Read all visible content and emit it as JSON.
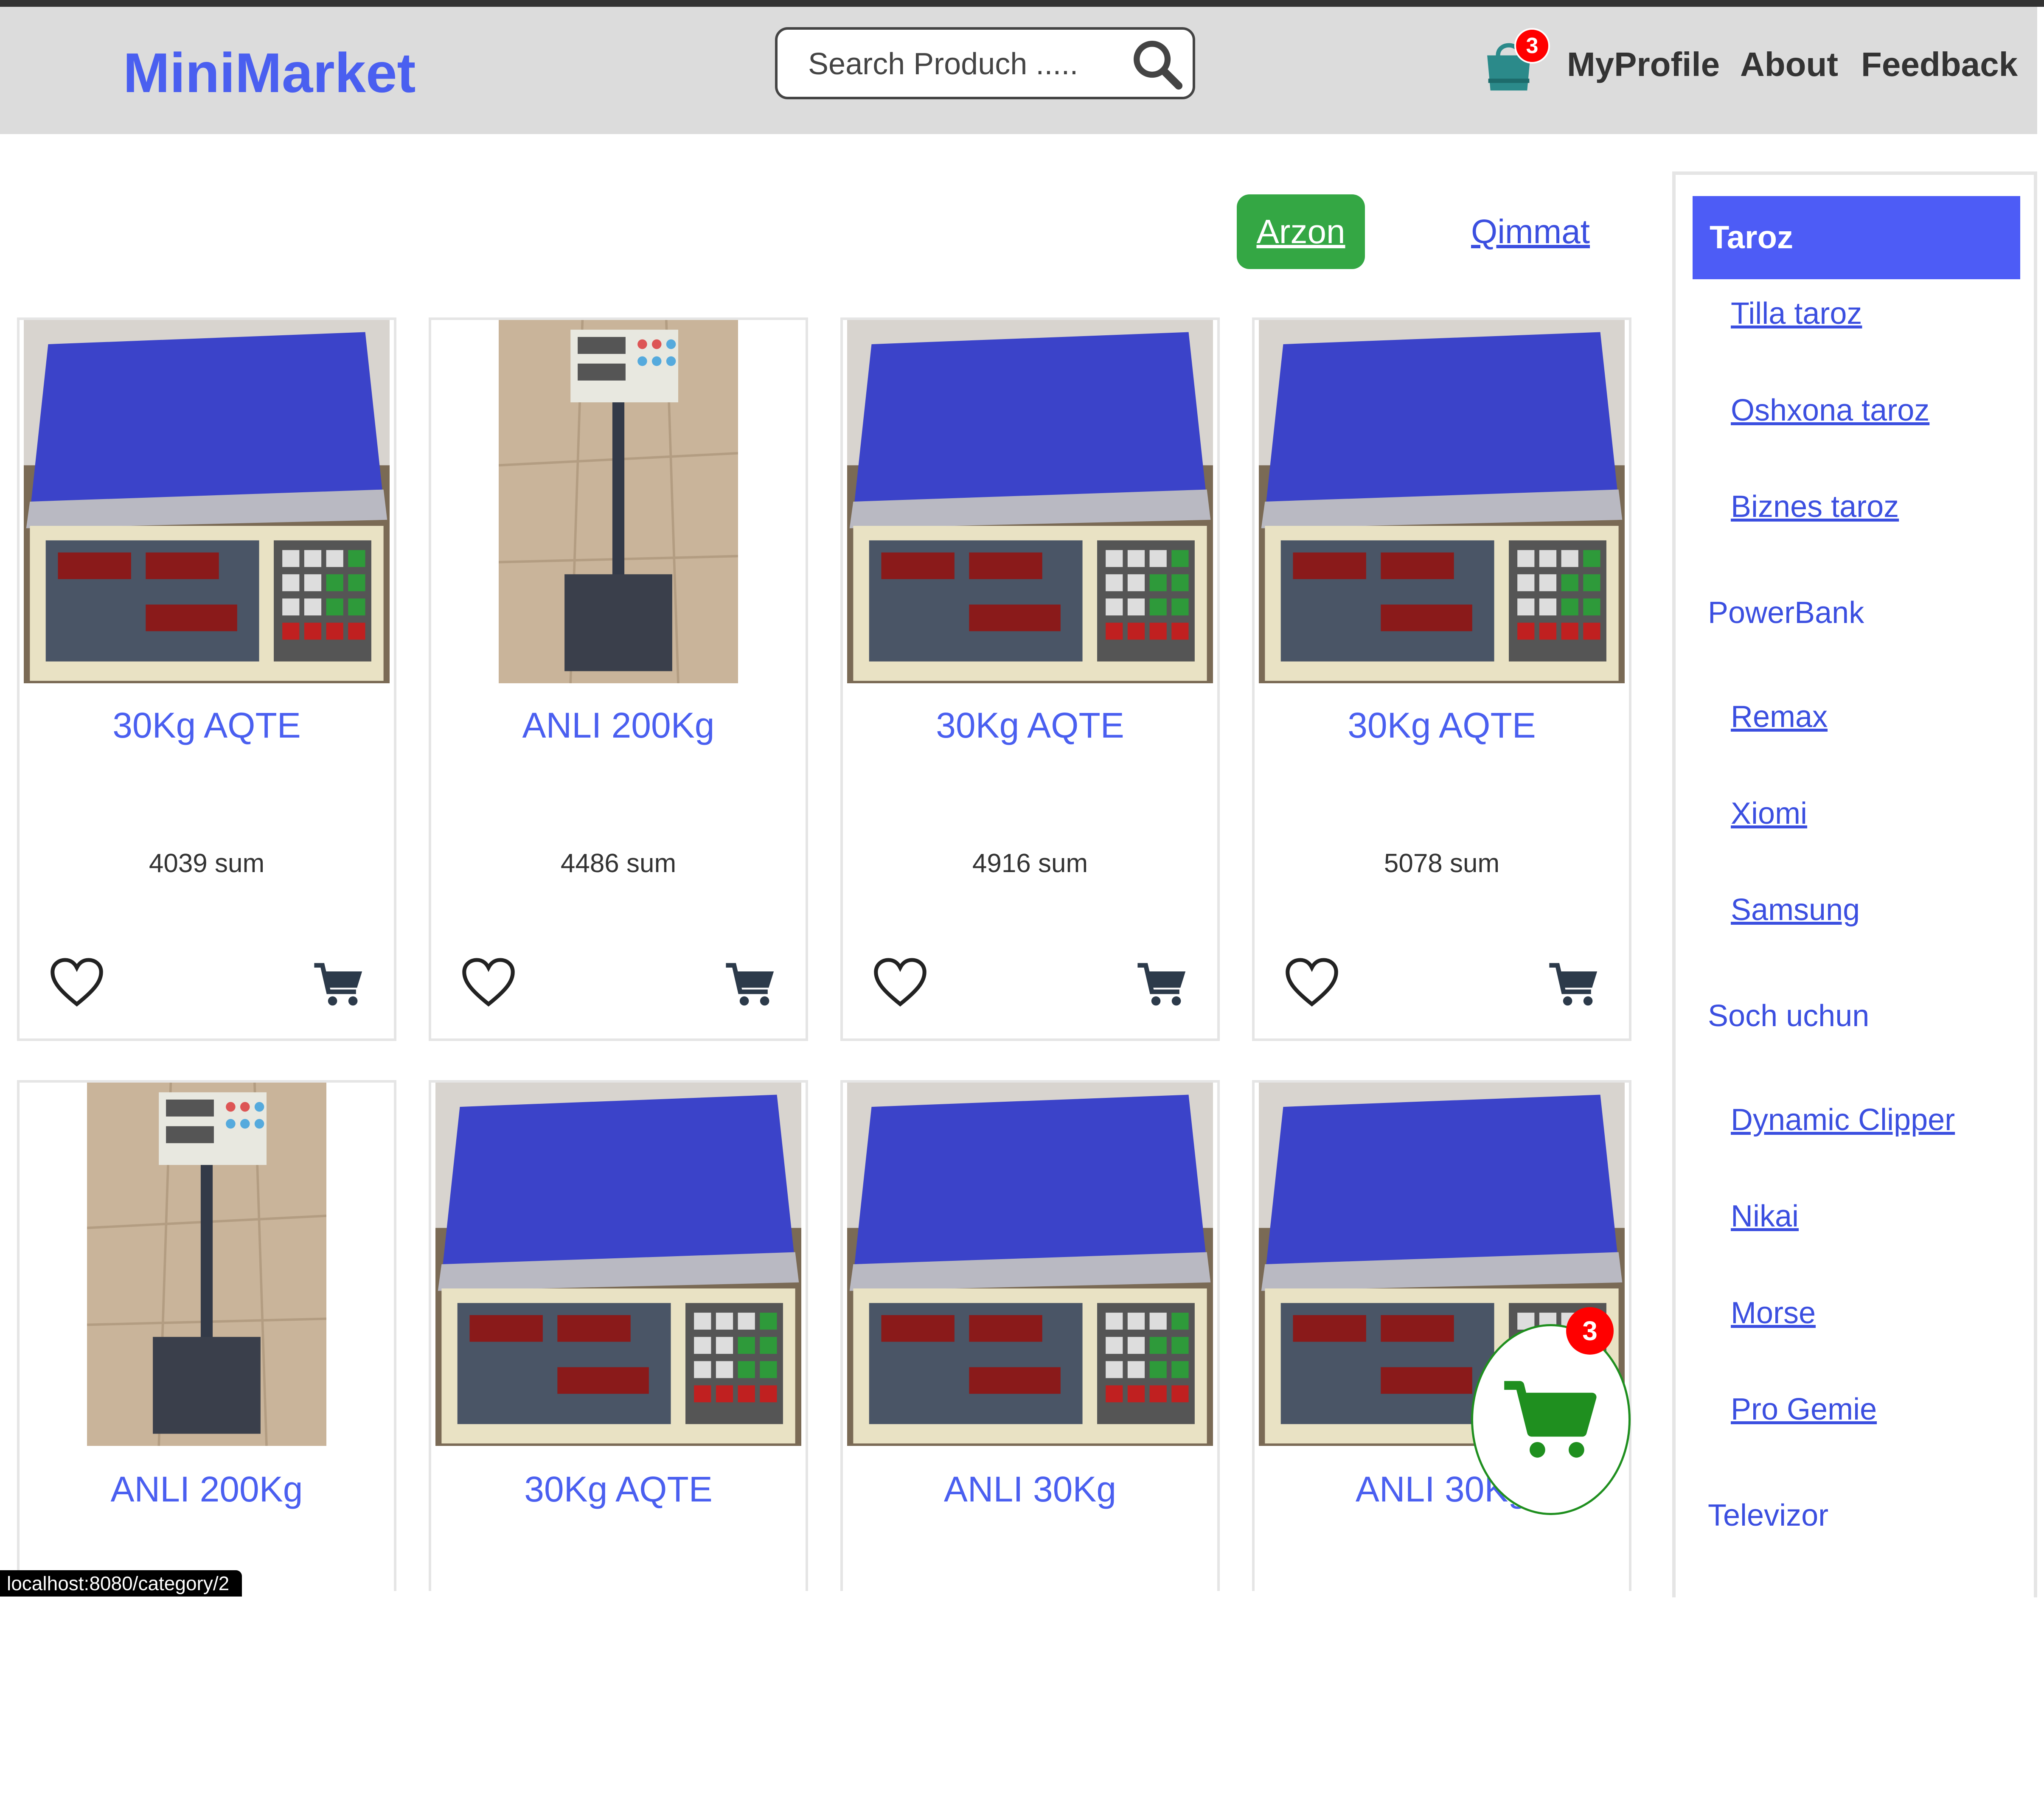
{
  "header": {
    "brand": "MiniMarket",
    "search_placeholder": "Search Produch .....",
    "cart_count": "3",
    "nav": [
      "MyProfile",
      "About",
      "Feedback"
    ]
  },
  "sort": {
    "active": "Arzon",
    "other": "Qimmat"
  },
  "products": [
    {
      "name": "30Kg AQTE",
      "price": "4039 sum",
      "image": "scale-counter"
    },
    {
      "name": "ANLI 200Kg",
      "price": "4486 sum",
      "image": "scale-platform"
    },
    {
      "name": "30Kg AQTE",
      "price": "4916 sum",
      "image": "scale-counter"
    },
    {
      "name": "30Kg AQTE",
      "price": "5078 sum",
      "image": "scale-counter"
    },
    {
      "name": "ANLI 200Kg",
      "price": "",
      "image": "scale-platform"
    },
    {
      "name": "30Kg AQTE",
      "price": "",
      "image": "scale-counter"
    },
    {
      "name": "ANLI 30Kg",
      "price": "",
      "image": "scale-counter"
    },
    {
      "name": "ANLI 30Kg",
      "price": "",
      "image": "scale-counter"
    }
  ],
  "sidebar": {
    "active": "Taroz",
    "items": [
      {
        "label": "Tilla taroz",
        "type": "sub"
      },
      {
        "label": "Oshxona taroz",
        "type": "sub"
      },
      {
        "label": "Biznes taroz",
        "type": "sub"
      },
      {
        "label": "PowerBank",
        "type": "main"
      },
      {
        "label": "Remax",
        "type": "sub"
      },
      {
        "label": "Xiomi",
        "type": "sub"
      },
      {
        "label": "Samsung",
        "type": "sub"
      },
      {
        "label": "Soch uchun",
        "type": "main"
      },
      {
        "label": "Dynamic Clipper",
        "type": "sub"
      },
      {
        "label": "Nikai",
        "type": "sub"
      },
      {
        "label": "Morse",
        "type": "sub"
      },
      {
        "label": "Pro Gemie",
        "type": "sub"
      },
      {
        "label": "Televizor",
        "type": "main"
      }
    ]
  },
  "floating_cart_count": "3",
  "status_url": "localhost:8080/category/2",
  "colors": {
    "brand": "#4a5ff0",
    "accent_green": "#34a744",
    "sidebar_active": "#4d5cf6",
    "badge": "#ff0000"
  },
  "icons": [
    "search-icon",
    "shopping-bag-icon",
    "heart-icon",
    "cart-icon"
  ]
}
